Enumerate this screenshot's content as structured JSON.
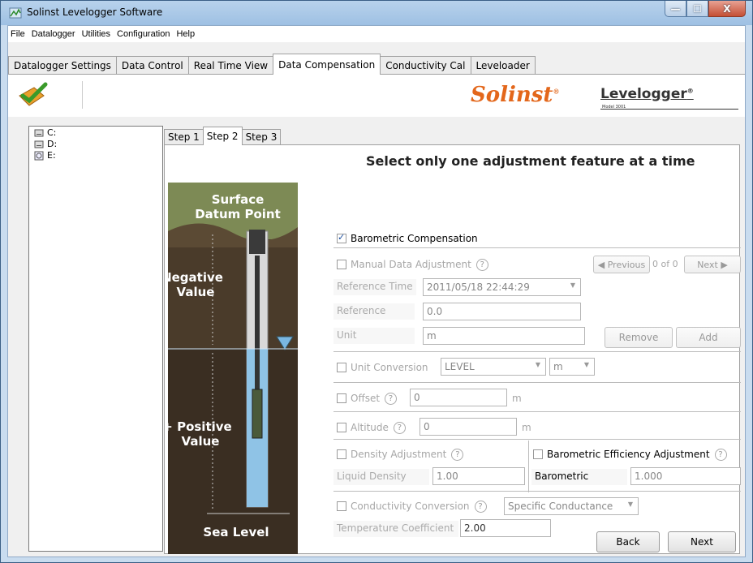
{
  "window": {
    "title": "Solinst Levelogger Software",
    "minimize": "—",
    "maximize": "☐",
    "close": "X"
  },
  "menu": [
    "File",
    "Datalogger",
    "Utilities",
    "Configuration",
    "Help"
  ],
  "main_tabs": [
    "Datalogger Settings",
    "Data Control",
    "Real Time View",
    "Data Compensation",
    "Conductivity Cal",
    "Leveloader"
  ],
  "brand": {
    "solinst": "Solinst",
    "levelogger": "Levelogger",
    "model": "Model 3001"
  },
  "drives": [
    "C:",
    "D:",
    "E:"
  ],
  "step_tabs": [
    "Step 1",
    "Step 2",
    "Step 3"
  ],
  "heading": "Select only one adjustment feature at a time",
  "illustration": {
    "surface": "Surface Datum Point",
    "negative": "Negative Value",
    "positive": "+ Positive Value",
    "sea": "Sea Level"
  },
  "form": {
    "baro_comp": "Barometric Compensation",
    "manual_adj": "Manual Data Adjustment",
    "help": "?",
    "previous": "Previous",
    "count": "0 of 0",
    "next_nav": "Next",
    "ref_time_label": "Reference Time",
    "ref_time_value": "2011/05/18 22:44:29",
    "reference_label": "Reference",
    "reference_value": "0.0",
    "unit_label": "Unit",
    "unit_value": "m",
    "remove": "Remove",
    "add": "Add",
    "unit_conv": "Unit Conversion",
    "unit_conv_type": "LEVEL",
    "unit_conv_unit": "m",
    "offset": "Offset",
    "offset_value": "0",
    "offset_unit": "m",
    "altitude": "Altitude",
    "altitude_value": "0",
    "altitude_unit": "m",
    "density_adj": "Density Adjustment",
    "baro_eff": "Barometric Efficiency Adjustment",
    "liquid_density_label": "Liquid Density",
    "liquid_density_value": "1.00",
    "barometric_label": "Barometric",
    "barometric_value": "1.000",
    "cond_conv": "Conductivity Conversion",
    "cond_type": "Specific Conductance",
    "temp_coeff_label": "Temperature Coefficient",
    "temp_coeff_value": "2.00",
    "back": "Back",
    "next": "Next"
  }
}
